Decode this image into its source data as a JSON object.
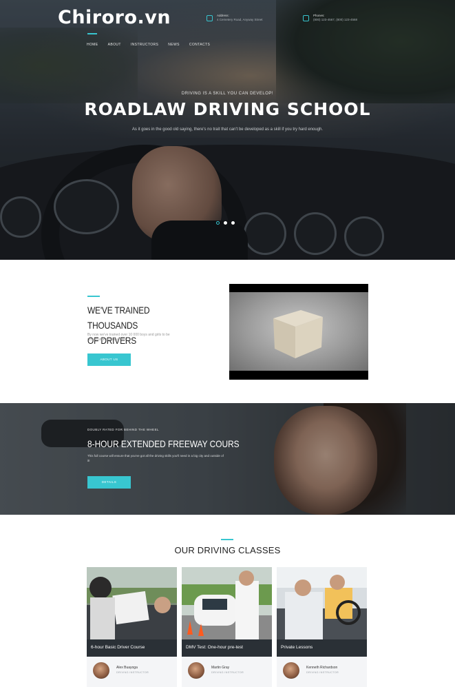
{
  "watermark": "Chiroro.vn",
  "nav": {
    "items": [
      "HOME",
      "ABOUT",
      "INSTRUCTORS",
      "NEWS",
      "CONTACTS"
    ]
  },
  "header_contacts": [
    {
      "icon": "location-icon",
      "label": "Address:",
      "value": "4 Cemetery Road, Anyway Street"
    },
    {
      "icon": "phone-icon",
      "label": "Phones:",
      "value": "(800) 123-4567, (800) 123-4568"
    }
  ],
  "hero": {
    "eyebrow": "DRIVING IS A SKILL YOU CAN DEVELOP!",
    "title": "ROADLAW DRIVING SCHOOL",
    "subtitle": "As it goes in the good old saying, there's no trait that can't be developed as a skill if you try hard enough.",
    "slide_count": 3,
    "active_slide": 1
  },
  "trained": {
    "title_line1": "WE'VE TRAINED THOUSANDS",
    "title_line2": "OF DRIVERS",
    "text": "By now we've trained over 10 000 boys and girls to be responsible road learners.",
    "button": "ABOUT US"
  },
  "freeway": {
    "eyebrow": "DOUBLY RATED FOR BEHIND THE WHEEL",
    "title": "8-HOUR EXTENDED FREEWAY COURS",
    "text": "This full course will ensure that you've got all the driving skills you'll need in a big city and outside of it!",
    "button": "DETAILS"
  },
  "classes": {
    "title": "OUR DRIVING CLASSES",
    "items": [
      {
        "title": "6-hour Basic Driver Course",
        "instructor": "Alex Buayoga",
        "role": "DRIVING INSTRUCTOR"
      },
      {
        "title": "DMV Test: One-hour pre-test",
        "instructor": "Martin Gray",
        "role": "DRIVING INSTRUCTOR"
      },
      {
        "title": "Private Lessons",
        "instructor": "Kenneth Richardson",
        "role": "DRIVING INSTRUCTOR"
      }
    ]
  },
  "colors": {
    "accent": "#38c6d0",
    "dark_band": "#2a3036"
  }
}
